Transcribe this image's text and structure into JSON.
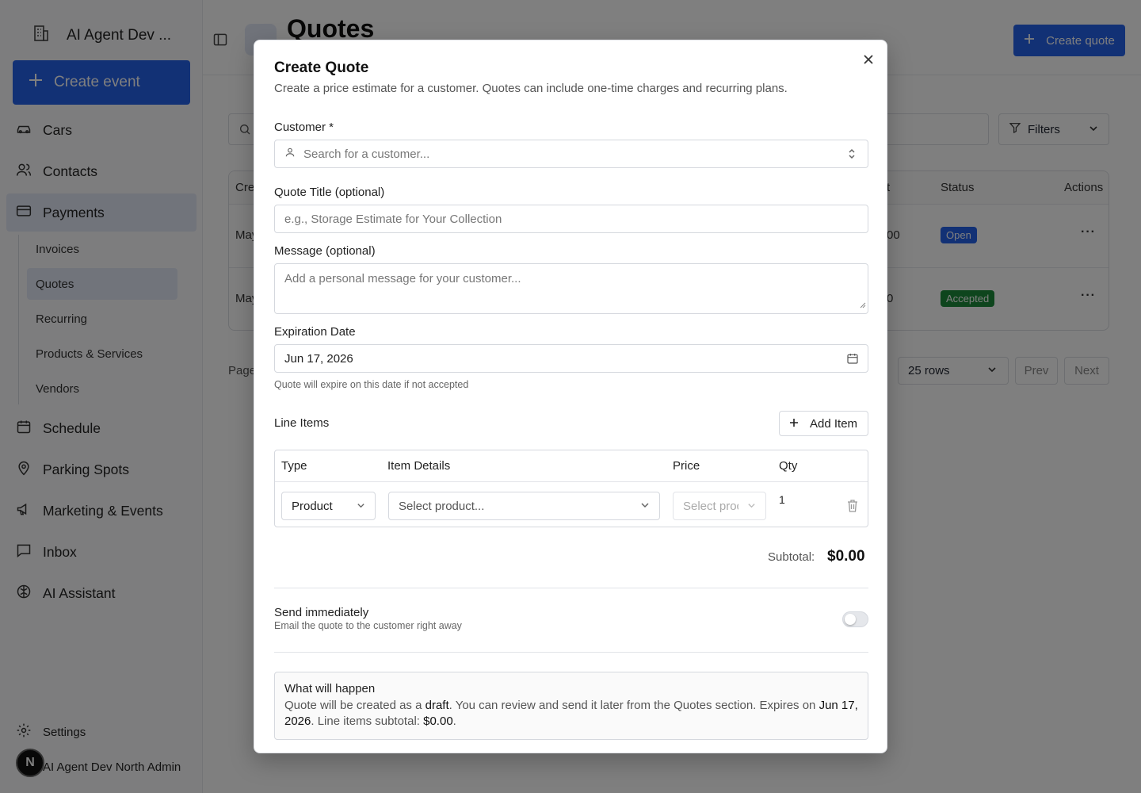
{
  "sidebar": {
    "org_name": "AI Agent Dev ...",
    "create_event_label": "Create event",
    "nav": {
      "cars": "Cars",
      "contacts": "Contacts",
      "payments": "Payments",
      "schedule": "Schedule",
      "parking": "Parking Spots",
      "marketing": "Marketing & Events",
      "inbox": "Inbox",
      "ai_assistant": "AI Assistant",
      "settings": "Settings"
    },
    "payments_sub": {
      "invoices": "Invoices",
      "quotes": "Quotes",
      "recurring": "Recurring",
      "products": "Products & Services",
      "vendors": "Vendors"
    },
    "user_initial": "N",
    "user_name": "AI Agent Dev North Admin"
  },
  "page": {
    "title": "Quotes",
    "create_quote_label": "Create quote",
    "filters_label": "Filters",
    "table": {
      "headers": {
        "created": "Cre",
        "amount": "t",
        "status": "Status",
        "actions": "Actions"
      },
      "rows": [
        {
          "created": "May",
          "amount": "00",
          "status": "Open",
          "actions": "···"
        },
        {
          "created": "May",
          "amount": "0",
          "status": "Accepted",
          "actions": "···"
        }
      ]
    },
    "pager_text": "Page",
    "rows_select": "25 rows",
    "prev_label": "Prev",
    "next_label": "Next"
  },
  "modal": {
    "title": "Create Quote",
    "description": "Create a price estimate for a customer. Quotes can include one-time charges and recurring plans.",
    "customer_label": "Customer *",
    "customer_placeholder": "Search for a customer...",
    "quote_title_label": "Quote Title (optional)",
    "quote_title_placeholder": "e.g., Storage Estimate for Your Collection",
    "message_label": "Message (optional)",
    "message_placeholder": "Add a personal message for your customer...",
    "expiration_label": "Expiration Date",
    "expiration_value": "Jun 17, 2026",
    "expiration_hint": "Quote will expire on this date if not accepted",
    "line_items_label": "Line Items",
    "add_item_label": "Add Item",
    "line_table": {
      "headers": {
        "type": "Type",
        "details": "Item Details",
        "price": "Price",
        "qty": "Qty"
      },
      "row": {
        "type": "Product",
        "details_placeholder": "Select product...",
        "price_placeholder": "Select proc",
        "qty": "1"
      }
    },
    "subtotal_label": "Subtotal:",
    "subtotal_value": "$0.00",
    "send_title": "Send immediately",
    "send_subtitle": "Email the quote to the customer right away",
    "send_enabled": false,
    "info_title": "What will happen",
    "info_body": {
      "p1": "Quote will be created as a ",
      "draft": "draft",
      "p2": ". You can review and send it later from the Quotes section. Expires on ",
      "date": "Jun 17, 2026",
      "p3": ". Line items subtotal: ",
      "subtotal": "$0.00",
      "p4": "."
    }
  },
  "colors": {
    "accent": "#2563eb",
    "accepted_badge": "#1d8a3a",
    "overlay": "rgba(0,0,0,0.5)"
  }
}
